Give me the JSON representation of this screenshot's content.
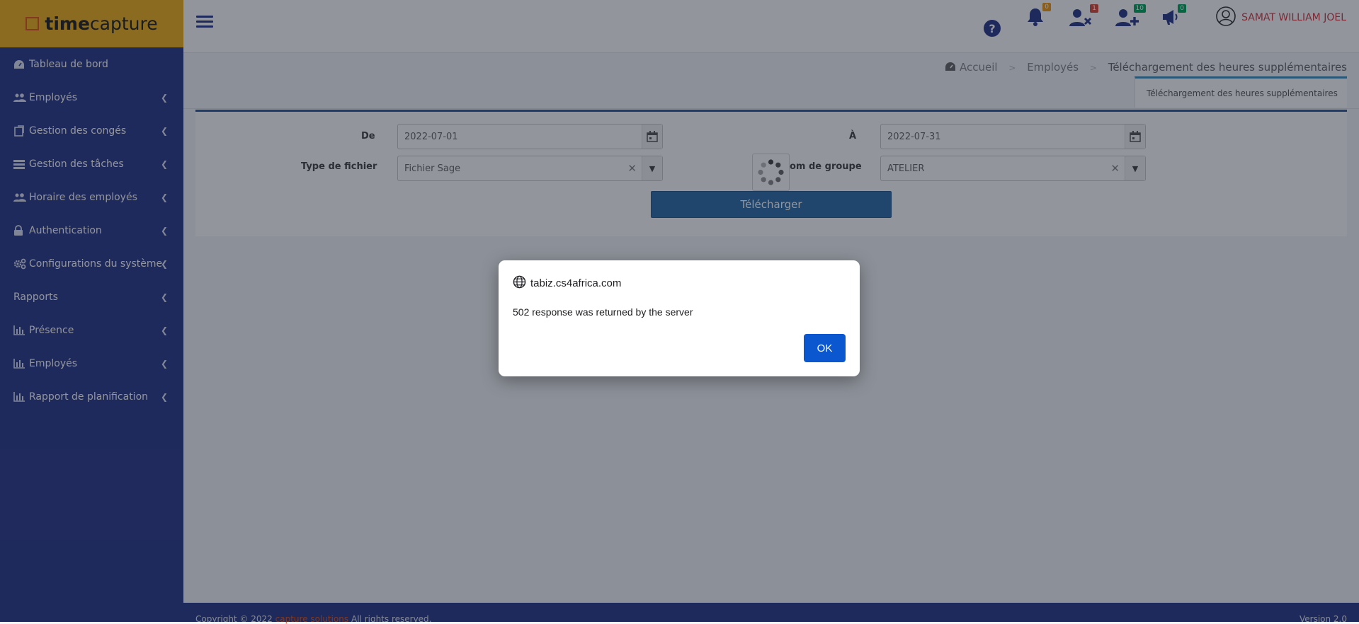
{
  "app": {
    "logo_bold": "time",
    "logo_rest": "capture"
  },
  "sidebar": {
    "items": [
      {
        "label": "Tableau de bord",
        "icon": "dashboard-icon",
        "has_chevron": false
      },
      {
        "label": "Employés",
        "icon": "users-icon",
        "has_chevron": true
      },
      {
        "label": "Gestion des congés",
        "icon": "leave-icon",
        "has_chevron": true
      },
      {
        "label": "Gestion des tâches",
        "icon": "tasks-icon",
        "has_chevron": true
      },
      {
        "label": "Horaire des employés",
        "icon": "users-icon",
        "has_chevron": true
      },
      {
        "label": "Authentication",
        "icon": "lock-icon",
        "has_chevron": true
      },
      {
        "label": "Configurations du système",
        "icon": "cogs-icon",
        "has_chevron": true
      },
      {
        "label": "Rapports",
        "icon": "",
        "has_chevron": true
      },
      {
        "label": "Présence",
        "icon": "bar-chart-icon",
        "has_chevron": true
      },
      {
        "label": "Employés",
        "icon": "bar-chart-icon",
        "has_chevron": true
      },
      {
        "label": "Rapport de planification",
        "icon": "bar-chart-icon",
        "has_chevron": true
      }
    ]
  },
  "topbar": {
    "badges": {
      "notifications": "0",
      "users_removed": "1",
      "users_added": "10",
      "announcements": "0"
    },
    "badge_colors": {
      "notifications": "#f39c12",
      "users_removed": "#dd4b39",
      "users_added": "#00a65a",
      "announcements": "#00a65a"
    },
    "user_name": "SAMAT WILLIAM JOEL"
  },
  "breadcrumb": {
    "home": "Accueil",
    "section": "Employés",
    "current": "Téléchargement des heures supplémentaires"
  },
  "tab": {
    "label": "Téléchargement des heures supplémentaires"
  },
  "form": {
    "from_label": "De",
    "from_value": "2022-07-01",
    "to_label": "À",
    "to_value": "2022-07-31",
    "file_type_label": "Type de fichier",
    "file_type_value": "Fichier Sage",
    "group_label": "om de groupe",
    "group_value": "ATELIER",
    "submit_label": "Télécharger"
  },
  "footer": {
    "copyright": "Copyright © 2022",
    "company": "capture solutions",
    "rights": "All rights reserved.",
    "version": "Version 2.0"
  },
  "dialog": {
    "origin": "tabiz.cs4africa.com",
    "message": "502 response was returned by the server",
    "ok_label": "OK"
  },
  "colors": {
    "sidebar": "#2b3a8a",
    "logo_bg": "#f2b21b",
    "accent": "#2f6ea8",
    "user_name": "#d9363e",
    "dialog_button": "#0b57d0"
  }
}
